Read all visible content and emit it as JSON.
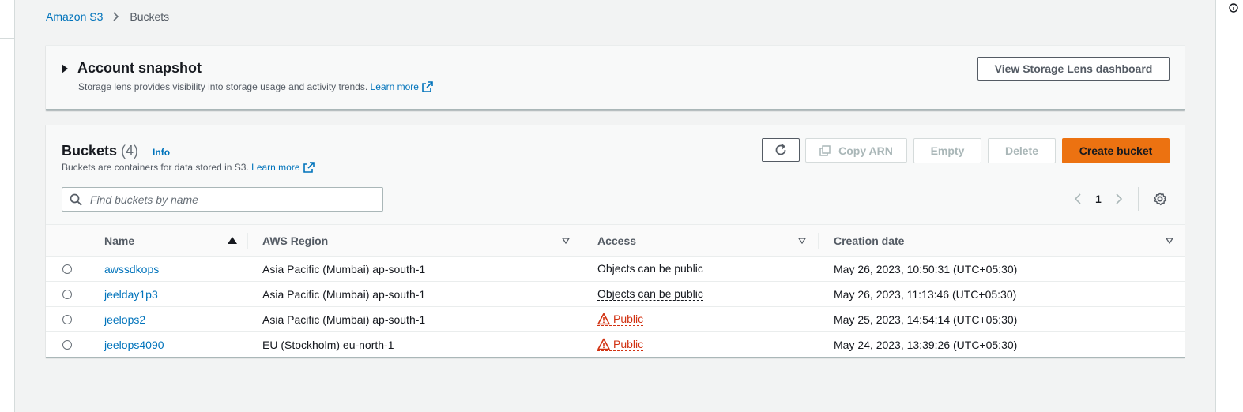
{
  "breadcrumb": {
    "root": "Amazon S3",
    "current": "Buckets"
  },
  "snapshot": {
    "title": "Account snapshot",
    "description": "Storage lens provides visibility into storage usage and activity trends.",
    "learn_more": "Learn more",
    "button": "View Storage Lens dashboard"
  },
  "buckets": {
    "title": "Buckets",
    "count": "(4)",
    "info": "Info",
    "description": "Buckets are containers for data stored in S3.",
    "learn_more": "Learn more",
    "actions": {
      "copy_arn": "Copy ARN",
      "empty": "Empty",
      "delete": "Delete",
      "create": "Create bucket"
    },
    "search": {
      "placeholder": "Find buckets by name",
      "value": ""
    },
    "pagination": {
      "page": "1"
    },
    "columns": {
      "name": "Name",
      "region": "AWS Region",
      "access": "Access",
      "created": "Creation date"
    },
    "rows": [
      {
        "name": "awssdkops",
        "region": "Asia Pacific (Mumbai) ap-south-1",
        "access": "Objects can be public",
        "public": false,
        "created": "May 26, 2023, 10:50:31 (UTC+05:30)"
      },
      {
        "name": "jeelday1p3",
        "region": "Asia Pacific (Mumbai) ap-south-1",
        "access": "Objects can be public",
        "public": false,
        "created": "May 26, 2023, 11:13:46 (UTC+05:30)"
      },
      {
        "name": "jeelops2",
        "region": "Asia Pacific (Mumbai) ap-south-1",
        "access": "Public",
        "public": true,
        "created": "May 25, 2023, 14:54:14 (UTC+05:30)"
      },
      {
        "name": "jeelops4090",
        "region": "EU (Stockholm) eu-north-1",
        "access": "Public",
        "public": true,
        "created": "May 24, 2023, 13:39:26 (UTC+05:30)"
      }
    ]
  },
  "colors": {
    "link": "#0073bb",
    "primary_button": "#ec7211",
    "danger": "#d13212",
    "background": "#f2f3f3"
  },
  "icons": [
    "chevron-right-icon",
    "external-link-icon",
    "refresh-icon",
    "copy-icon",
    "search-icon",
    "chevron-left-icon",
    "gear-icon",
    "sort-asc-icon",
    "sort-desc-icon",
    "warning-icon",
    "info-circle-icon"
  ]
}
